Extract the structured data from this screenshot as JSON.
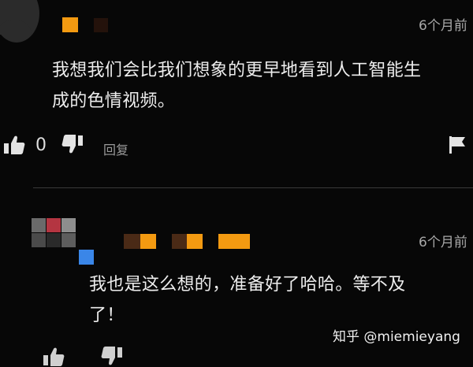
{
  "comments": [
    {
      "timestamp": "6个月前",
      "text_line1": "我想我们会比我们想象的更早地看到人工智能生",
      "text_line2": "成的色情视频。",
      "like_count": "0",
      "reply_label": "回复"
    },
    {
      "timestamp": "6个月前",
      "text_line1": "我也是这么想的，准备好了哈哈。等不及",
      "text_line2": "了！"
    }
  ],
  "watermark": "知乎 @miemieyang",
  "colors": {
    "background": "#070707",
    "name_blur_orange": "#f39a11",
    "name_blur_brown": "#4a2a16",
    "avatar_blue": "#3a86e8",
    "avatar_red": "#b43541"
  },
  "icons": [
    "avatar-placeholder",
    "thumbs-up-icon",
    "thumbs-down-icon",
    "flag-icon"
  ]
}
